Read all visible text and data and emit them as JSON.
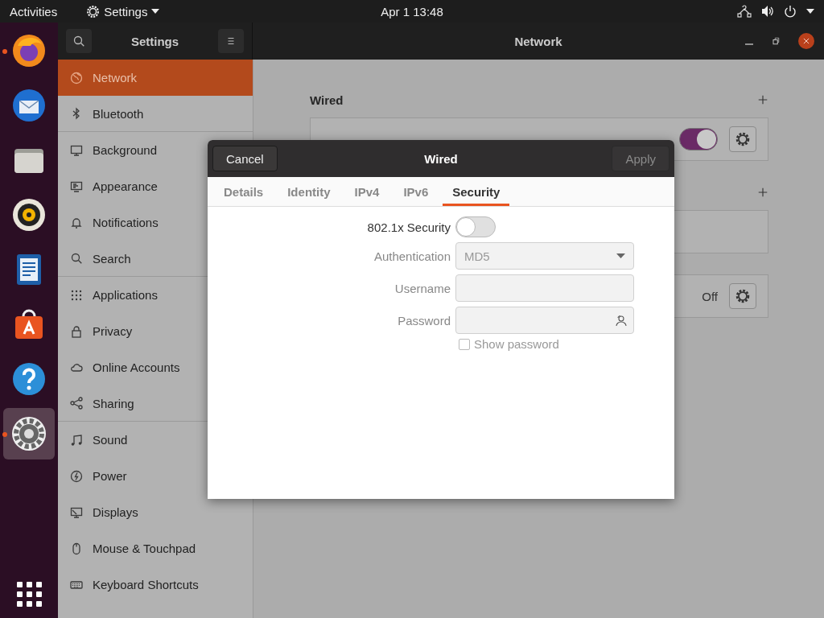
{
  "top_bar": {
    "activities": "Activities",
    "app_menu": "Settings",
    "clock": "Apr 1  13:48"
  },
  "dock": {
    "apps": [
      {
        "running": true,
        "selected": false
      },
      {
        "running": false,
        "selected": false
      },
      {
        "running": false,
        "selected": false
      },
      {
        "running": false,
        "selected": false
      },
      {
        "running": false,
        "selected": false
      },
      {
        "running": false,
        "selected": false
      },
      {
        "running": false,
        "selected": false
      },
      {
        "running": true,
        "selected": true
      }
    ]
  },
  "window": {
    "sidebar_title": "Settings",
    "title": "Network"
  },
  "sidebar": {
    "items": [
      {
        "label": "Network",
        "selected": true,
        "separator_after": false
      },
      {
        "label": "Bluetooth",
        "selected": false,
        "separator_after": true
      },
      {
        "label": "Background",
        "selected": false,
        "separator_after": false
      },
      {
        "label": "Appearance",
        "selected": false,
        "separator_after": false
      },
      {
        "label": "Notifications",
        "selected": false,
        "separator_after": false
      },
      {
        "label": "Search",
        "selected": false,
        "separator_after": true
      },
      {
        "label": "Applications",
        "selected": false,
        "separator_after": false
      },
      {
        "label": "Privacy",
        "selected": false,
        "separator_after": false
      },
      {
        "label": "Online Accounts",
        "selected": false,
        "separator_after": false
      },
      {
        "label": "Sharing",
        "selected": false,
        "separator_after": true
      },
      {
        "label": "Sound",
        "selected": false,
        "separator_after": false
      },
      {
        "label": "Power",
        "selected": false,
        "separator_after": false
      },
      {
        "label": "Displays",
        "selected": false,
        "separator_after": false
      },
      {
        "label": "Mouse & Touchpad",
        "selected": false,
        "separator_after": false
      },
      {
        "label": "Keyboard Shortcuts",
        "selected": false,
        "separator_after": false
      }
    ]
  },
  "wired": {
    "heading": "Wired",
    "on": true
  },
  "section_2": {
    "status": "Off"
  },
  "dialog": {
    "title": "Wired",
    "cancel": "Cancel",
    "apply": {
      "label": "Apply",
      "disabled": true
    },
    "tabs": [
      {
        "label": "Details",
        "selected": false
      },
      {
        "label": "Identity",
        "selected": false
      },
      {
        "label": "IPv4",
        "selected": false
      },
      {
        "label": "IPv6",
        "selected": false
      },
      {
        "label": "Security",
        "selected": true
      }
    ],
    "security": {
      "label": "802.1x Security",
      "on": false
    },
    "fields": [
      {
        "kind": "dropdown",
        "label": "Authentication",
        "value": "MD5",
        "disabled": true
      },
      {
        "kind": "text",
        "label": "Username",
        "disabled": true
      },
      {
        "kind": "password",
        "label": "Password",
        "disabled": true
      }
    ],
    "show_password": {
      "label": "Show password",
      "checked": false,
      "disabled": true
    }
  }
}
